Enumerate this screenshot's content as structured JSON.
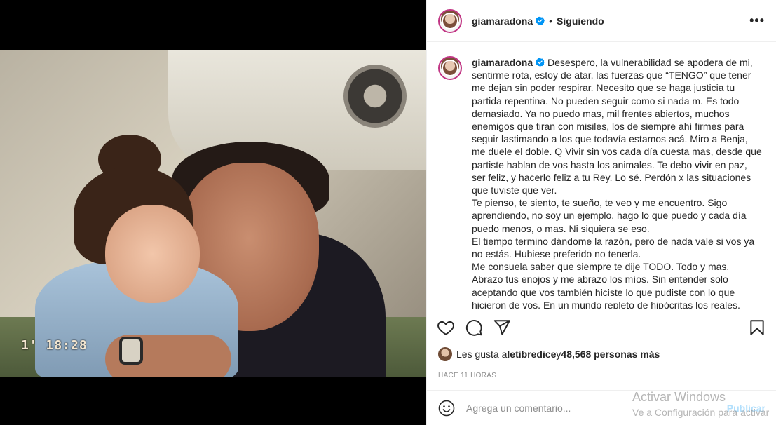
{
  "post": {
    "photo_stamp": "1' 18:28"
  },
  "header": {
    "username": "giamaradona",
    "separator": "•",
    "follow_status": "Siguiendo",
    "more_label": "•••"
  },
  "caption": {
    "username": "giamaradona",
    "text": " Desespero, la vulnerabilidad se apodera de mi, sentirme rota, estoy de atar, las fuerzas que “TENGO” que tener me dejan sin poder respirar. Necesito que se haga justicia tu partida repentina. No pueden seguir como si nada m. Es todo demasiado. Ya no puedo mas, mil frentes abiertos, muchos enemigos que tiran con misiles, los de siempre ahí firmes para seguir lastimando a los que todavía estamos acá. Miro a Benja, me duele el doble. Q Vivir sin vos cada día cuesta mas, desde que partiste hablan de vos hasta los animales. Te debo vivir en paz, ser feliz, y hacerlo feliz a tu Rey. Lo sé. Perdón x las situaciones que tuviste que ver.\nTe pienso, te siento, te sueño, te veo y me encuentro. Sigo aprendiendo, no soy un ejemplo, hago lo que puedo y cada día puedo menos, o mas. Ni siquiera se eso.\nEl tiempo termino dándome la razón, pero de nada vale si vos ya no estás. Hubiese preferido no tenerla.\nMe consuela saber que siempre te dije TODO. Todo y mas.\nAbrazo tus enojos y me abrazo los míos. Sin entender solo aceptando que vos también hiciste lo que pudiste con lo que hicieron de vos. En un mundo repleto de hipócritas los reales, diferentes, los que viven sin pedir explicaciones, los que hacen lo"
  },
  "likes": {
    "prefix": "Les gusta a ",
    "user": "letibredice",
    "middle": " y ",
    "count": "48,568 personas más"
  },
  "timestamp": "HACE 11 HORAS",
  "comment": {
    "placeholder": "Agrega un comentario...",
    "post_label": "Publicar"
  },
  "watermark": {
    "line1": "Activar Windows",
    "line2": "Ve a Configuración para activar"
  },
  "colors": {
    "verified_blue": "#0095f6",
    "avatar_ring": "#c13584",
    "publish_disabled": "#b2dffc"
  }
}
